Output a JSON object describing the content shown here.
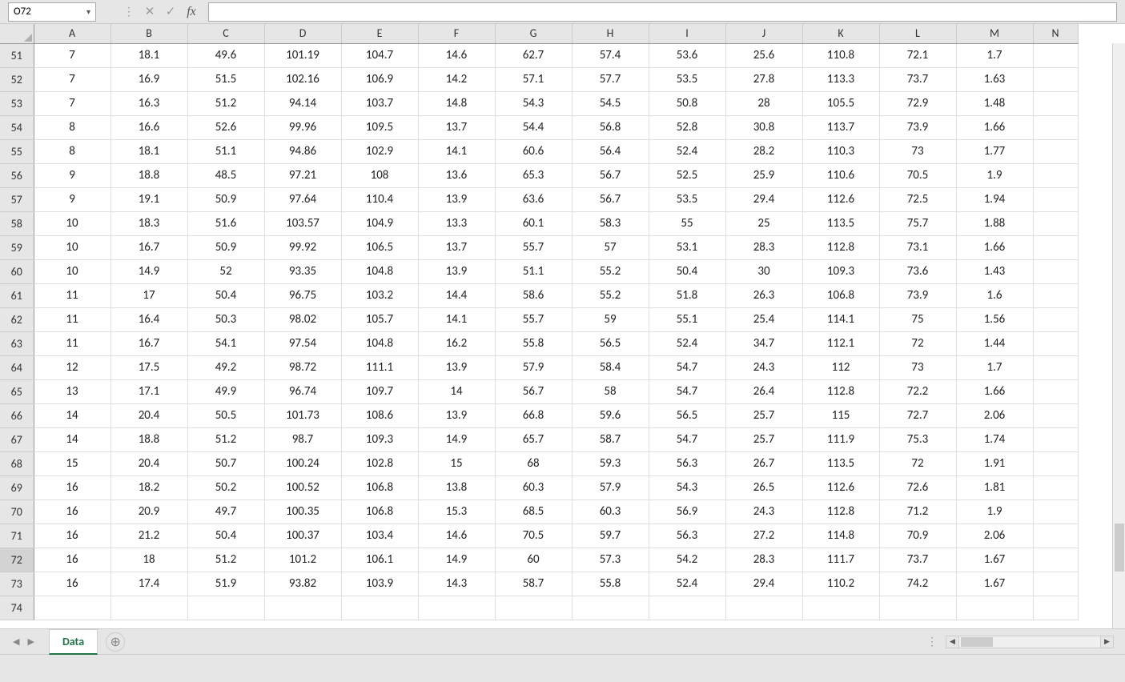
{
  "nameBox": "O72",
  "formulaValue": "",
  "columns": [
    "A",
    "B",
    "C",
    "D",
    "E",
    "F",
    "G",
    "H",
    "I",
    "J",
    "K",
    "L",
    "M",
    "N"
  ],
  "rowStart": 51,
  "rowEnd": 74,
  "activeRow": 72,
  "sheetTab": "Data",
  "addSheetGlyph": "⊕",
  "navLeft": "◀",
  "navRight": "▶",
  "hscrollLeft": "◀",
  "hscrollRight": "▶",
  "fxLabel": "fx",
  "cancelGlyph": "✕",
  "enterGlyph": "✓",
  "dropdownGlyph": "▾",
  "vdotsGlyph": "⋮",
  "chart_data": {
    "type": "table",
    "columns_shown": [
      "A",
      "B",
      "C",
      "D",
      "E",
      "F",
      "G",
      "H",
      "I",
      "J",
      "K",
      "L",
      "M"
    ],
    "rows": {
      "51": [
        "7",
        "18.1",
        "49.6",
        "101.19",
        "104.7",
        "14.6",
        "62.7",
        "57.4",
        "53.6",
        "25.6",
        "110.8",
        "72.1",
        "1.7"
      ],
      "52": [
        "7",
        "16.9",
        "51.5",
        "102.16",
        "106.9",
        "14.2",
        "57.1",
        "57.7",
        "53.5",
        "27.8",
        "113.3",
        "73.7",
        "1.63"
      ],
      "53": [
        "7",
        "16.3",
        "51.2",
        "94.14",
        "103.7",
        "14.8",
        "54.3",
        "54.5",
        "50.8",
        "28",
        "105.5",
        "72.9",
        "1.48"
      ],
      "54": [
        "8",
        "16.6",
        "52.6",
        "99.96",
        "109.5",
        "13.7",
        "54.4",
        "56.8",
        "52.8",
        "30.8",
        "113.7",
        "73.9",
        "1.66"
      ],
      "55": [
        "8",
        "18.1",
        "51.1",
        "94.86",
        "102.9",
        "14.1",
        "60.6",
        "56.4",
        "52.4",
        "28.2",
        "110.3",
        "73",
        "1.77"
      ],
      "56": [
        "9",
        "18.8",
        "48.5",
        "97.21",
        "108",
        "13.6",
        "65.3",
        "56.7",
        "52.5",
        "25.9",
        "110.6",
        "70.5",
        "1.9"
      ],
      "57": [
        "9",
        "19.1",
        "50.9",
        "97.64",
        "110.4",
        "13.9",
        "63.6",
        "56.7",
        "53.5",
        "29.4",
        "112.6",
        "72.5",
        "1.94"
      ],
      "58": [
        "10",
        "18.3",
        "51.6",
        "103.57",
        "104.9",
        "13.3",
        "60.1",
        "58.3",
        "55",
        "25",
        "113.5",
        "75.7",
        "1.88"
      ],
      "59": [
        "10",
        "16.7",
        "50.9",
        "99.92",
        "106.5",
        "13.7",
        "55.7",
        "57",
        "53.1",
        "28.3",
        "112.8",
        "73.1",
        "1.66"
      ],
      "60": [
        "10",
        "14.9",
        "52",
        "93.35",
        "104.8",
        "13.9",
        "51.1",
        "55.2",
        "50.4",
        "30",
        "109.3",
        "73.6",
        "1.43"
      ],
      "61": [
        "11",
        "17",
        "50.4",
        "96.75",
        "103.2",
        "14.4",
        "58.6",
        "55.2",
        "51.8",
        "26.3",
        "106.8",
        "73.9",
        "1.6"
      ],
      "62": [
        "11",
        "16.4",
        "50.3",
        "98.02",
        "105.7",
        "14.1",
        "55.7",
        "59",
        "55.1",
        "25.4",
        "114.1",
        "75",
        "1.56"
      ],
      "63": [
        "11",
        "16.7",
        "54.1",
        "97.54",
        "104.8",
        "16.2",
        "55.8",
        "56.5",
        "52.4",
        "34.7",
        "112.1",
        "72",
        "1.44"
      ],
      "64": [
        "12",
        "17.5",
        "49.2",
        "98.72",
        "111.1",
        "13.9",
        "57.9",
        "58.4",
        "54.7",
        "24.3",
        "112",
        "73",
        "1.7"
      ],
      "65": [
        "13",
        "17.1",
        "49.9",
        "96.74",
        "109.7",
        "14",
        "56.7",
        "58",
        "54.7",
        "26.4",
        "112.8",
        "72.2",
        "1.66"
      ],
      "66": [
        "14",
        "20.4",
        "50.5",
        "101.73",
        "108.6",
        "13.9",
        "66.8",
        "59.6",
        "56.5",
        "25.7",
        "115",
        "72.7",
        "2.06"
      ],
      "67": [
        "14",
        "18.8",
        "51.2",
        "98.7",
        "109.3",
        "14.9",
        "65.7",
        "58.7",
        "54.7",
        "25.7",
        "111.9",
        "75.3",
        "1.74"
      ],
      "68": [
        "15",
        "20.4",
        "50.7",
        "100.24",
        "102.8",
        "15",
        "68",
        "59.3",
        "56.3",
        "26.7",
        "113.5",
        "72",
        "1.91"
      ],
      "69": [
        "16",
        "18.2",
        "50.2",
        "100.52",
        "106.8",
        "13.8",
        "60.3",
        "57.9",
        "54.3",
        "26.5",
        "112.6",
        "72.6",
        "1.81"
      ],
      "70": [
        "16",
        "20.9",
        "49.7",
        "100.35",
        "106.8",
        "15.3",
        "68.5",
        "60.3",
        "56.9",
        "24.3",
        "112.8",
        "71.2",
        "1.9"
      ],
      "71": [
        "16",
        "21.2",
        "50.4",
        "100.37",
        "103.4",
        "14.6",
        "70.5",
        "59.7",
        "56.3",
        "27.2",
        "114.8",
        "70.9",
        "2.06"
      ],
      "72": [
        "16",
        "18",
        "51.2",
        "101.2",
        "106.1",
        "14.9",
        "60",
        "57.3",
        "54.2",
        "28.3",
        "111.7",
        "73.7",
        "1.67"
      ],
      "73": [
        "16",
        "17.4",
        "51.9",
        "93.82",
        "103.9",
        "14.3",
        "58.7",
        "55.8",
        "52.4",
        "29.4",
        "110.2",
        "74.2",
        "1.67"
      ],
      "74": [
        "",
        "",
        "",
        "",
        "",
        "",
        "",
        "",
        "",
        "",
        "",
        "",
        "",
        ""
      ]
    }
  }
}
